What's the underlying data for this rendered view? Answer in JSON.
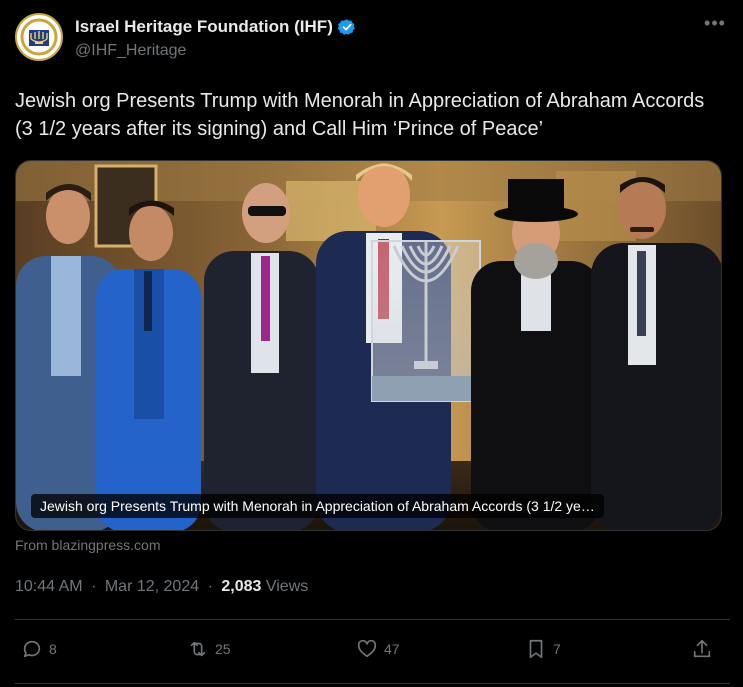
{
  "author": {
    "display_name": "Israel Heritage Foundation (IHF)",
    "handle": "@IHF_Heritage",
    "avatar_icon": "ihf-menorah-logo-icon",
    "verified_icon": "verified-badge-icon",
    "verified_color": "#1d9bf0"
  },
  "tweet": {
    "text": "Jewish org Presents Trump with Menorah in Appreciation of Abraham Accords (3 1/2 years after its signing) and Call Him ‘Prince of Peace’"
  },
  "media": {
    "caption": "Jewish org Presents Trump with Menorah in Appreciation of Abraham Accords (3 1/2 ye…",
    "source": "From blazingpress.com"
  },
  "meta": {
    "time": "10:44 AM",
    "separator": "·",
    "date": "Mar 12, 2024",
    "views_count": "2,083",
    "views_label": "Views"
  },
  "actions": {
    "reply": {
      "icon": "reply-icon",
      "count": "8"
    },
    "repost": {
      "icon": "repost-icon",
      "count": "25"
    },
    "like": {
      "icon": "heart-icon",
      "count": "47"
    },
    "bookmark": {
      "icon": "bookmark-icon",
      "count": "7"
    },
    "share": {
      "icon": "share-icon"
    }
  },
  "colors": {
    "background": "#000000",
    "text": "#e7e9ea",
    "muted": "#71767b",
    "border": "#2f3336"
  }
}
